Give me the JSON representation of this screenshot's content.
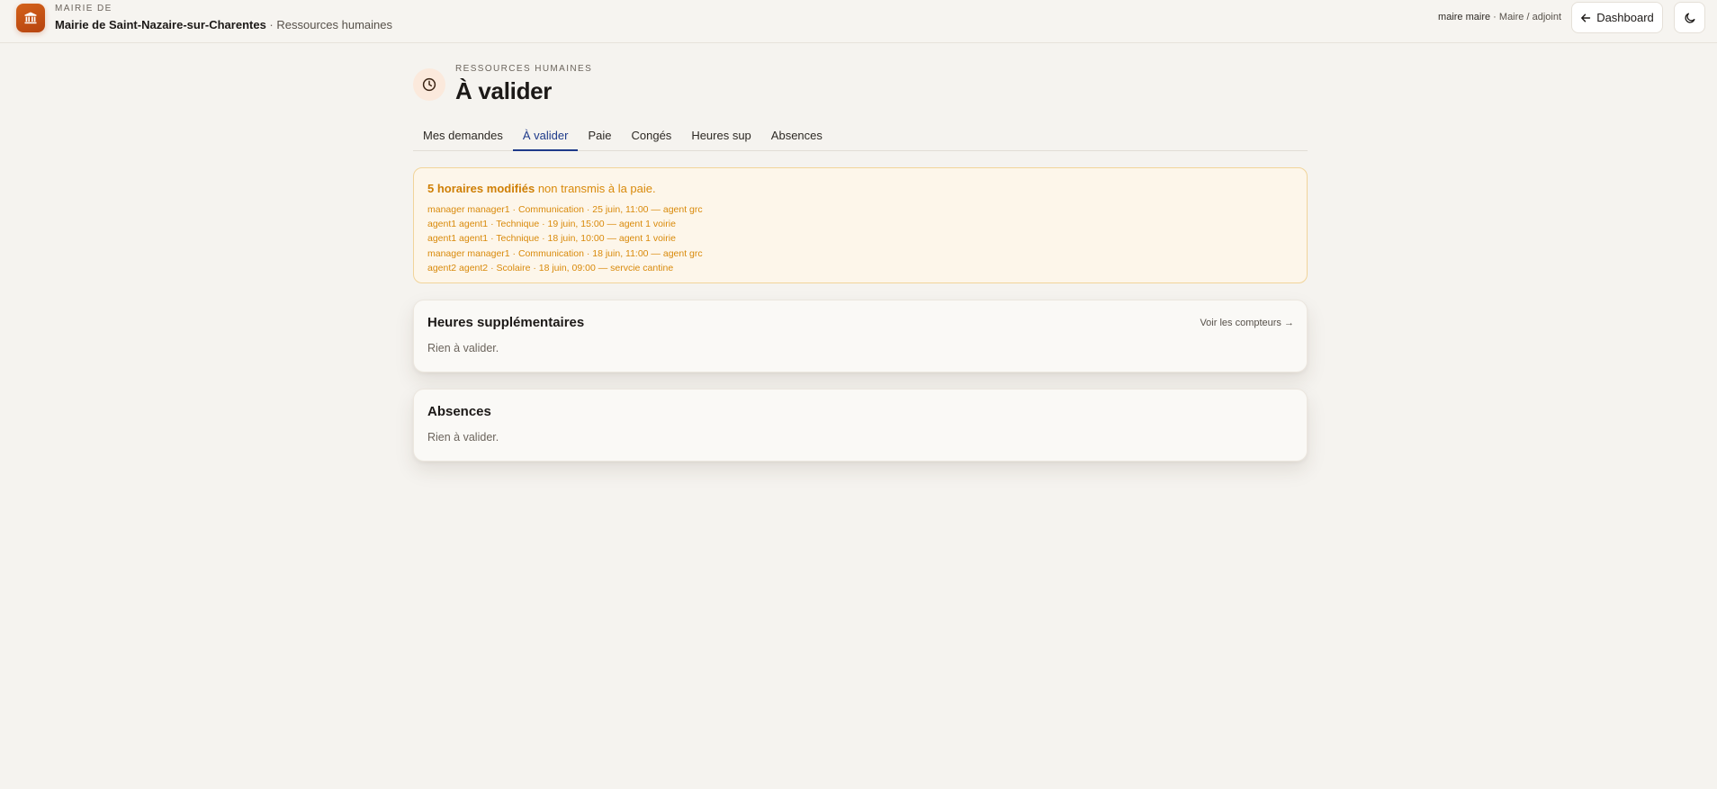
{
  "header": {
    "kicker": "MAIRIE DE",
    "org_name": "Mairie de Saint-Nazaire-sur-Charentes",
    "separator": " · ",
    "section": "Ressources humaines",
    "user_name": "maire maire",
    "user_sep": " · ",
    "user_role": "Maire / adjoint",
    "dashboard_label": "Dashboard",
    "logo_icon": "town-hall-icon",
    "theme_icon": "moon-icon"
  },
  "page": {
    "kicker": "RESSOURCES HUMAINES",
    "title": "À valider",
    "icon": "clock-icon"
  },
  "tabs": [
    {
      "label": "Mes demandes",
      "active": false
    },
    {
      "label": "À valider",
      "active": true
    },
    {
      "label": "Paie",
      "active": false
    },
    {
      "label": "Congés",
      "active": false
    },
    {
      "label": "Heures sup",
      "active": false
    },
    {
      "label": "Absences",
      "active": false
    }
  ],
  "alert": {
    "count_label": "5 horaires modifiés",
    "message": " non transmis à la paie.",
    "items": [
      "manager manager1 · Communication · 25 juin, 11:00 — agent grc",
      "agent1 agent1 · Technique · 19 juin, 15:00 — agent 1 voirie",
      "agent1 agent1 · Technique · 18 juin, 10:00 — agent 1 voirie",
      "manager manager1 · Communication · 18 juin, 11:00 — agent grc",
      "agent2 agent2 · Scolaire · 18 juin, 09:00 — servcie cantine"
    ]
  },
  "overtime": {
    "title": "Heures supplémentaires",
    "link": "Voir les compteurs →",
    "empty": "Rien à valider."
  },
  "absences": {
    "title": "Absences",
    "empty": "Rien à valider."
  },
  "colors": {
    "accent": "#c2410c",
    "tab_active": "#1e3a8a",
    "warning_text": "#d98a0b",
    "warning_bg": "#fdf6ea"
  }
}
